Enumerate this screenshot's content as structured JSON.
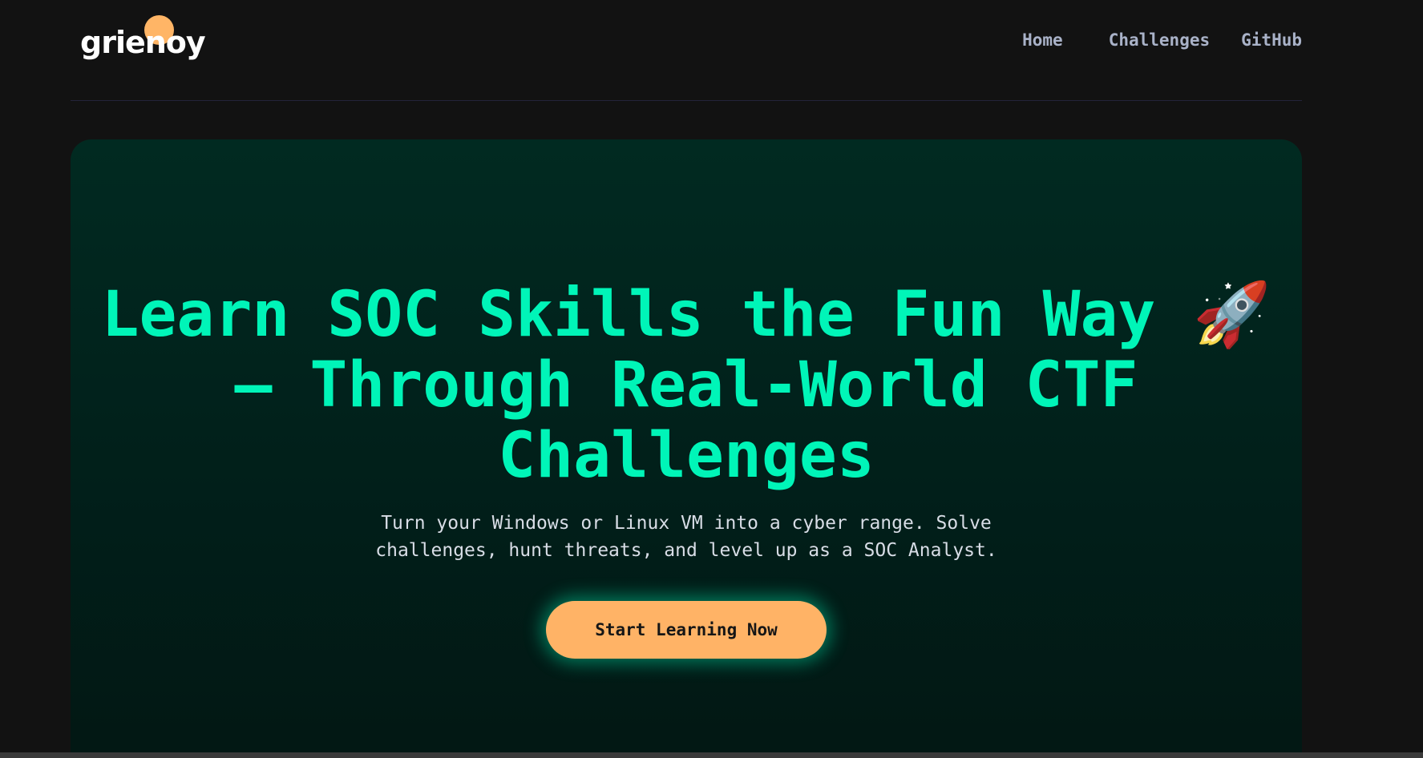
{
  "header": {
    "logo_text": "grienoy",
    "nav": {
      "home": "Home",
      "challenges": "Challenges",
      "github": "GitHub"
    }
  },
  "hero": {
    "title": "Learn SOC Skills the Fun Way 🚀 — Through Real-World CTF Challenges",
    "subtitle": "Turn your Windows or Linux VM into a cyber range. Solve challenges, hunt threats, and level up as a SOC Analyst.",
    "cta_label": "Start Learning Now"
  },
  "colors": {
    "page_background": "#121212",
    "accent_green": "#00f5b8",
    "accent_orange": "#ffb366",
    "hero_background": "#012a21"
  },
  "icons": {
    "title_emoji": "rocket-icon"
  }
}
